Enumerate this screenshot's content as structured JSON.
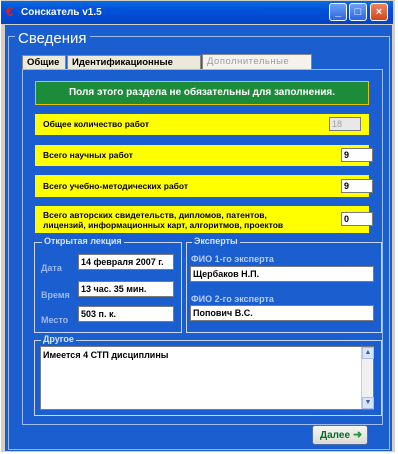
{
  "window": {
    "title": "Сонскатель v1.5",
    "icon": "app-icon",
    "controls": [
      "minimize-icon",
      "maximize-icon",
      "close-icon"
    ]
  },
  "group_title": "Сведения",
  "tabs": [
    {
      "label": "Общие",
      "active": false
    },
    {
      "label": "Идентификационные",
      "active": false
    },
    {
      "label": "Дополнительные",
      "active": true
    }
  ],
  "notice": "Поля этого раздела не обязательны для заполнения.",
  "counts": [
    {
      "label": "Общее количество работ",
      "value": "18",
      "disabled": true
    },
    {
      "label": "Всего научных работ",
      "value": "9",
      "disabled": false
    },
    {
      "label": "Всего учебно-методических работ",
      "value": "9",
      "disabled": false
    },
    {
      "label_line1": "Всего авторских свидетельств, дипломов, патентов,",
      "label_line2": "лицензий, информационных карт, алгоритмов, проектов",
      "value": "0",
      "disabled": false
    }
  ],
  "lecture": {
    "legend": "Открытая лекция",
    "date_label": "Дата",
    "date_value": "14 февраля 2007 г.",
    "time_label": "Время",
    "time_value": "13 час. 35 мин.",
    "place_label": "Место",
    "place_value": "503 п. к."
  },
  "experts": {
    "legend": "Эксперты",
    "expert1_label": "ФИО 1-го эксперта",
    "expert1_value": "Щербаков Н.П.",
    "expert2_label": "ФИО 2-го эксперта",
    "expert2_value": "Попович В.С."
  },
  "other": {
    "legend": "Другое",
    "text": "Имеется 4 СТП дисциплины"
  },
  "next_button": "Далее",
  "colors": {
    "panel": "#1a5ecf",
    "highlight": "#ffff00",
    "notice": "#1d8c3a"
  }
}
